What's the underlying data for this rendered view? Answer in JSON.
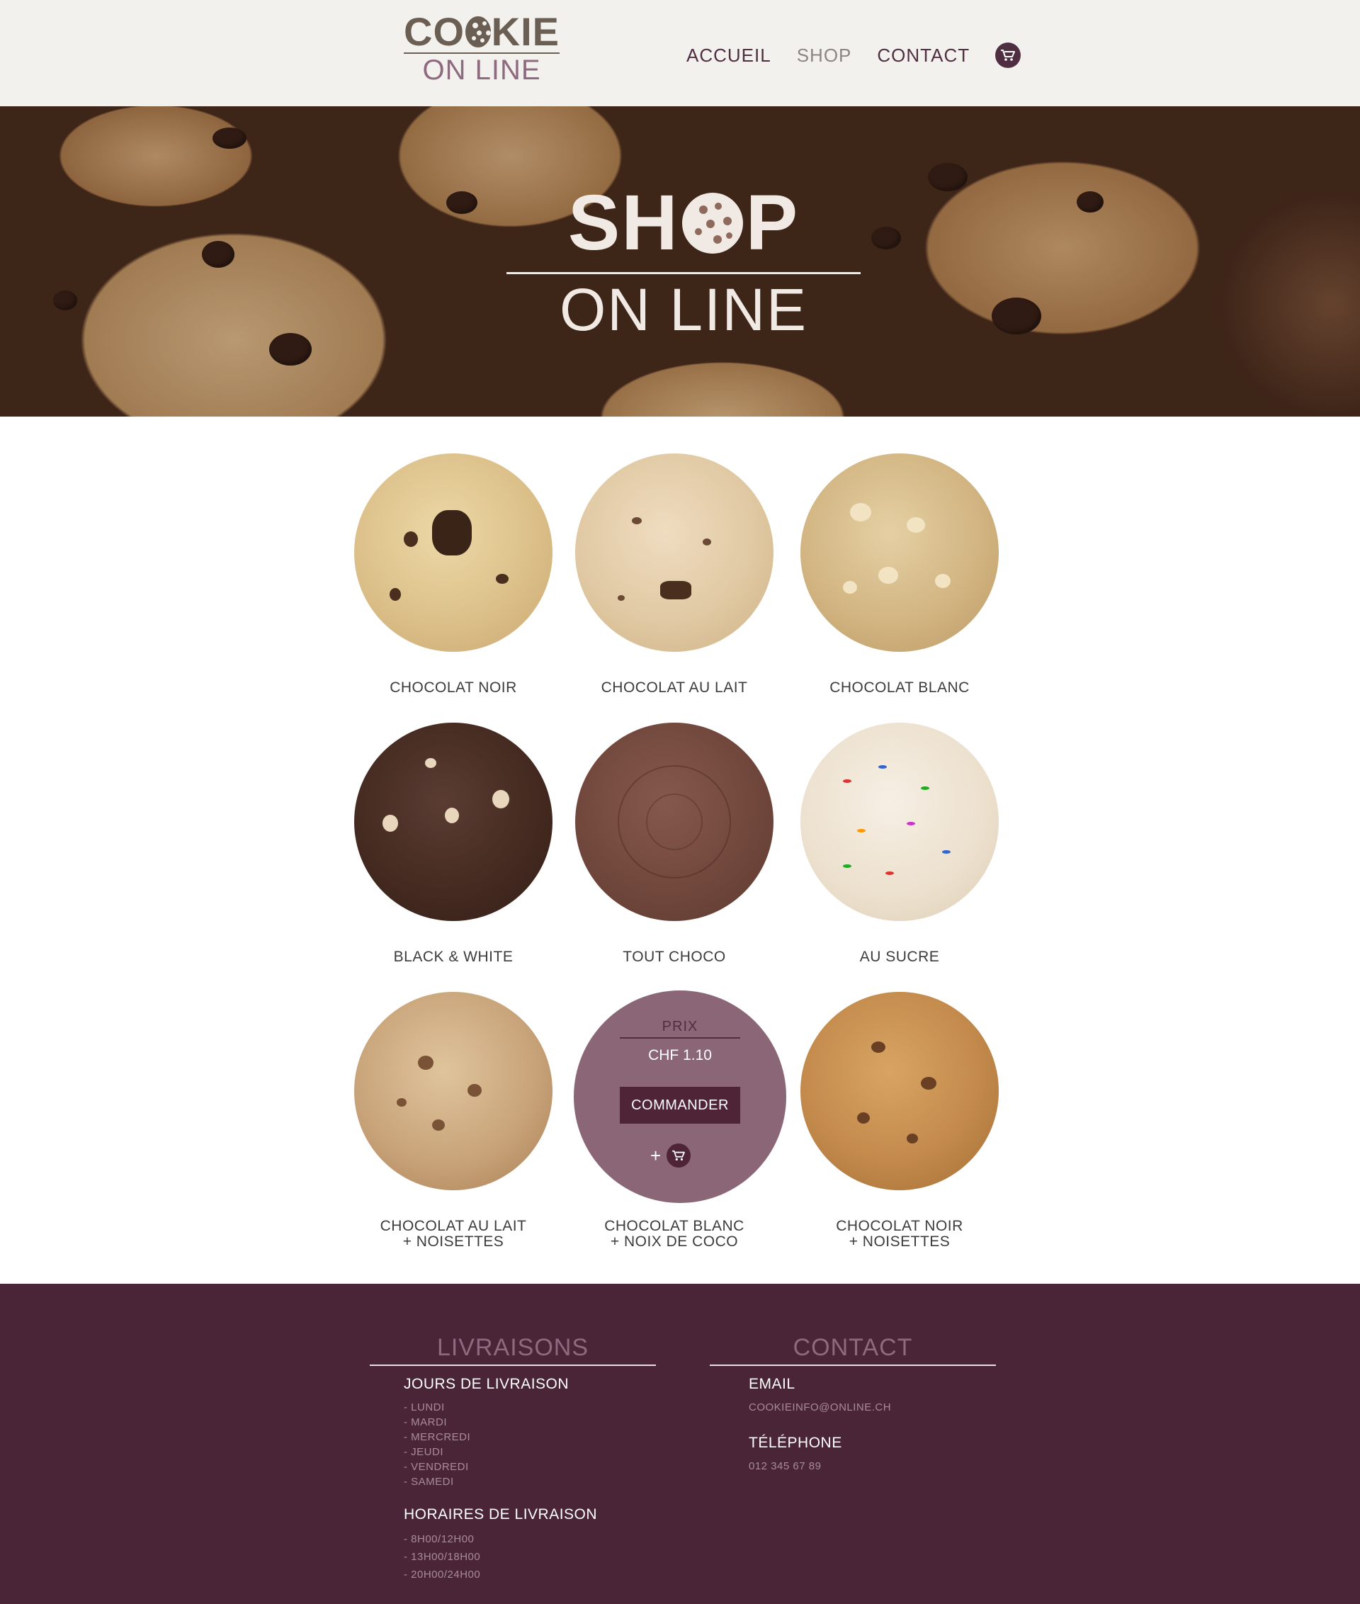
{
  "brand": {
    "logo_top": [
      "CO",
      "KIE"
    ],
    "logo_bottom": "ON LINE"
  },
  "nav": {
    "items": [
      {
        "label": "ACCUEIL",
        "active": false
      },
      {
        "label": "SHOP",
        "active": true
      },
      {
        "label": "CONTACT",
        "active": false
      }
    ],
    "cart_icon": "cart-icon"
  },
  "hero": {
    "title_left": "SH",
    "title_right": "P",
    "subtitle": "ON LINE"
  },
  "products": [
    {
      "name": "CHOCOLAT NOIR",
      "sub": ""
    },
    {
      "name": "CHOCOLAT AU LAIT",
      "sub": ""
    },
    {
      "name": "CHOCOLAT BLANC",
      "sub": ""
    },
    {
      "name": "BLACK & WHITE",
      "sub": ""
    },
    {
      "name": "TOUT CHOCO",
      "sub": ""
    },
    {
      "name": "AU SUCRE",
      "sub": ""
    },
    {
      "name": "CHOCOLAT AU LAIT",
      "sub": "+ NOISETTES"
    },
    {
      "name": "CHOCOLAT BLANC",
      "sub": "+ NOIX DE COCO"
    },
    {
      "name": "CHOCOLAT NOIR",
      "sub": "+ NOISETTES"
    }
  ],
  "price_card": {
    "label": "PRIX",
    "value": "CHF 1.10",
    "button": "COMMANDER",
    "add_symbol": "+"
  },
  "footer": {
    "livraisons": {
      "title": "LIVRAISONS",
      "days_title": "JOURS DE LIVRAISON",
      "days": [
        "- LUNDI",
        "- MARDI",
        "- MERCREDI",
        "- JEUDI",
        "- VENDREDI",
        "- SAMEDI"
      ],
      "hours_title": "HORAIRES DE LIVRAISON",
      "hours": [
        "- 8H00/12H00",
        "- 13H00/18H00",
        "- 20H00/24H00"
      ]
    },
    "contact": {
      "title": "CONTACT",
      "email_label": "EMAIL",
      "email": "COOKIEINFO@ONLINE.CH",
      "phone_label": "TÉLÉPHONE",
      "phone": "012 345 67 89"
    }
  },
  "colors": {
    "plum": "#4a2537",
    "mauve": "#8b6677",
    "header_bg": "#f3f1ee",
    "logo_brown": "#6b5e52"
  }
}
